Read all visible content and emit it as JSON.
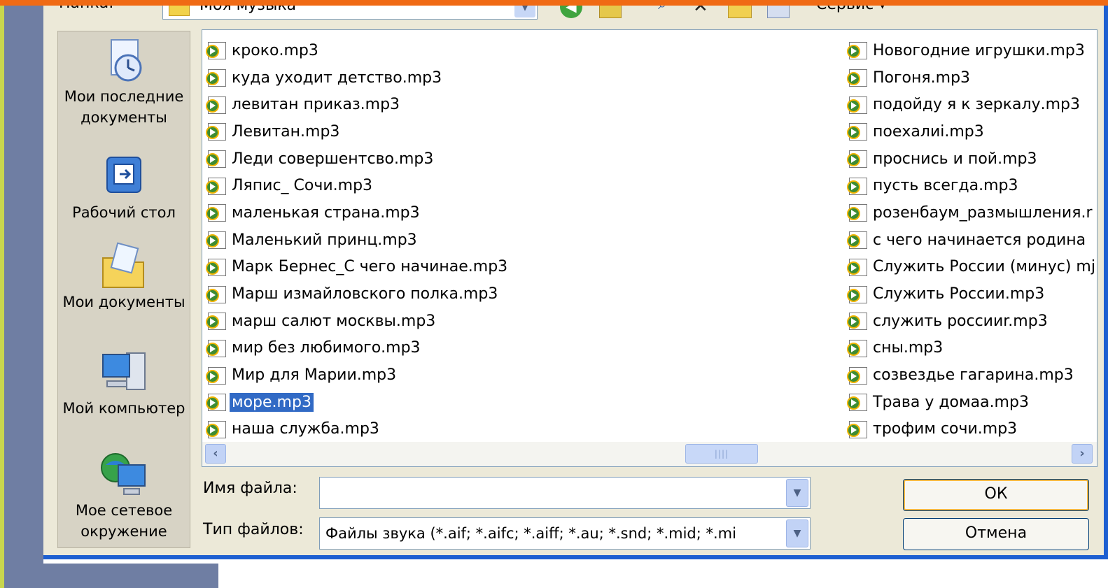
{
  "dialog": {
    "look_in_label": "Папка:",
    "look_in_value": "Моя музыка",
    "tools_label": "Сервис"
  },
  "places": [
    {
      "label": "Мои последние документы",
      "icon": "recent-documents-icon"
    },
    {
      "label": "Рабочий стол",
      "icon": "desktop-icon"
    },
    {
      "label": "Мои документы",
      "icon": "my-documents-icon"
    },
    {
      "label": "Мой компьютер",
      "icon": "my-computer-icon"
    },
    {
      "label": "Мое сетевое окружение",
      "icon": "network-places-icon"
    }
  ],
  "files": {
    "left": [
      "кроко.mp3",
      "куда уходит детство.mp3",
      "левитан приказ.mp3",
      "Левитан.mp3",
      "Леди совершентсво.mp3",
      "Ляпис_ Сочи.mp3",
      "маленькая страна.mp3",
      "Маленький принц.mp3",
      "Марк Бернес_С чего начинае.mp3",
      "Марш измайловского полка.mp3",
      "марш салют москвы.mp3",
      "мир без любимого.mp3",
      "Мир для Марии.mp3",
      "море.mp3",
      "наша служба.mp3"
    ],
    "right": [
      "Новогодние игрушки.mp3",
      "Погоня.mp3",
      "подойду я к зеркалу.mp3",
      "поехалиi.mp3",
      "проснись и пой.mp3",
      "пусть всегда.mp3",
      "розенбаум_размышления.r",
      "с чего начинается родина",
      "Служить России (минус) mj",
      "Служить России.mp3",
      "служить россииr.mp3",
      "сны.mp3",
      "созвездье гагарина.mp3",
      "Трава у домаа.mp3",
      "трофим сочи.mp3"
    ],
    "selected": "море.mp3"
  },
  "form": {
    "filename_label": "Имя файла:",
    "filename_value": "",
    "filetype_label": "Тип файлов:",
    "filetype_value": "Файлы звука (*.aif; *.aifc; *.aiff; *.au; *.snd; *.mid; *.mi",
    "ok_label": "ОК",
    "cancel_label": "Отмена"
  },
  "colors": {
    "selection": "#316ac5",
    "dialog_bg": "#ece9d8",
    "frame_blue": "#1d5fd1",
    "top_bar": "#f06a14"
  }
}
